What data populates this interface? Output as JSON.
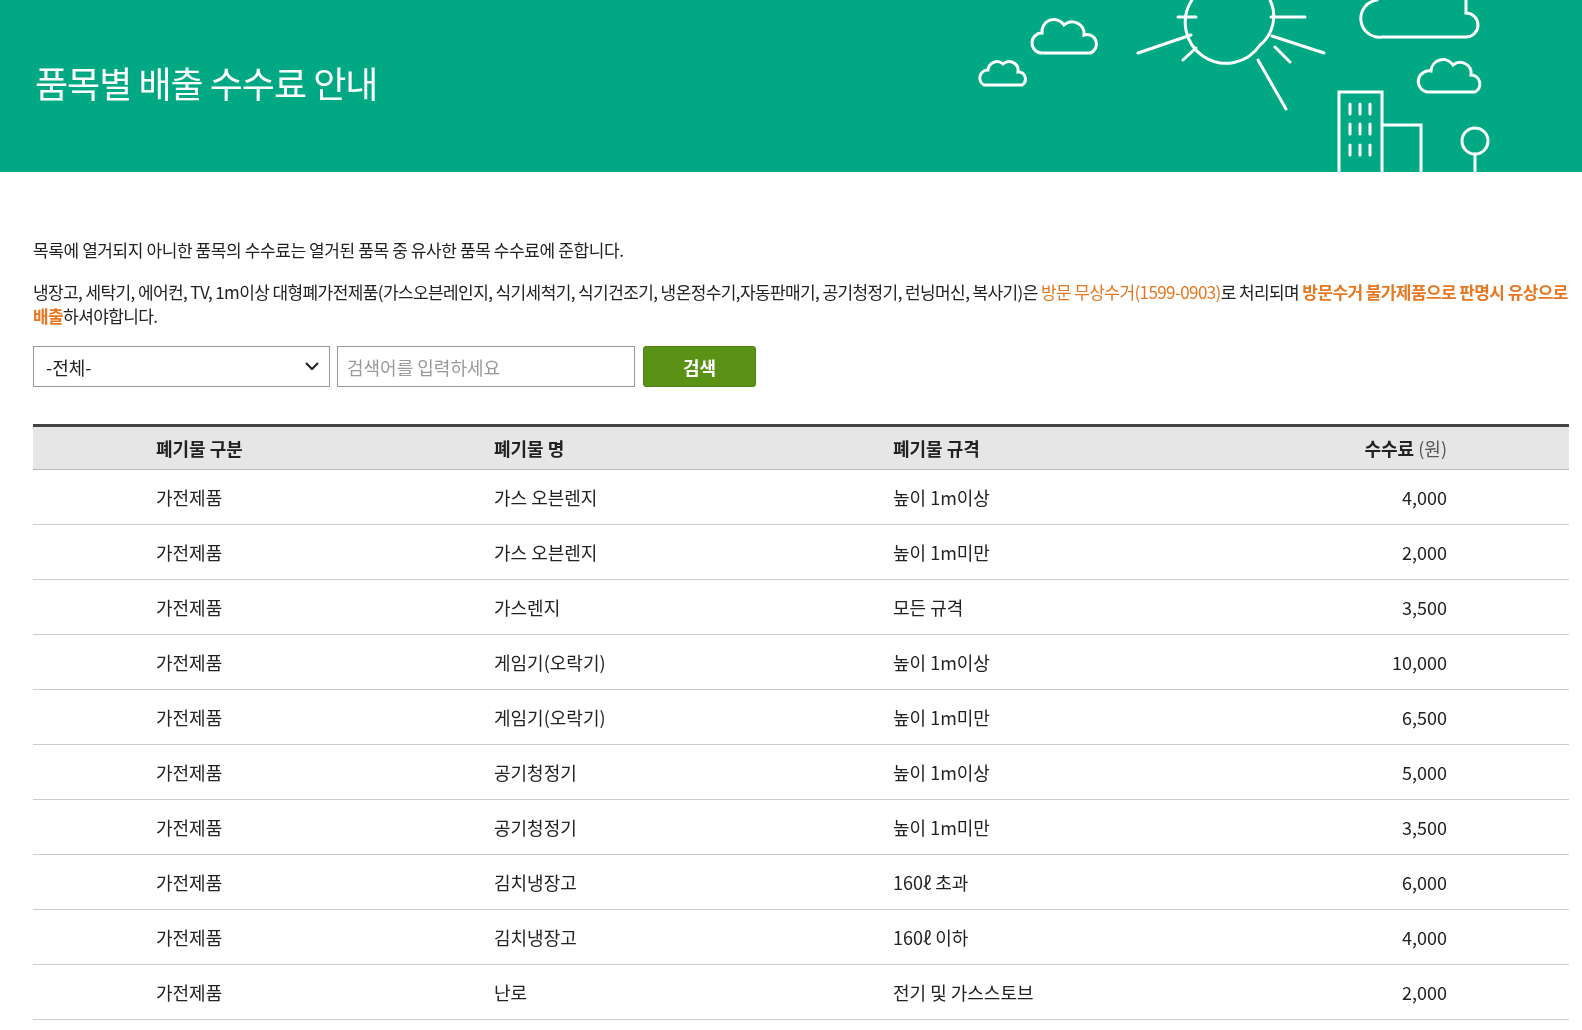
{
  "page_title": "품목별 배출 수수료 안내",
  "notice": "목록에 열거되지 아니한 품목의 수수료는 열거된 품목 중 유사한 품목 수수료에 준합니다.",
  "info": [
    {
      "kind": "plain",
      "text": "냉장고, 세탁기, 에어컨, TV, 1m이상 대형폐가전제품(가스오븐레인지, 식기세척기, 식기건조기, 냉온정수기,자동판매기, 공기청정기, 런닝머신, 복사기)은 "
    },
    {
      "kind": "highlight",
      "text": "방문 무상수거(1599-0903)"
    },
    {
      "kind": "plain",
      "text": "로 처리되며 "
    },
    {
      "kind": "strong",
      "text": "방문수거 불가제품으로 판명시 유상으로 배출"
    },
    {
      "kind": "plain",
      "text": "하셔야합니다."
    }
  ],
  "search": {
    "category": "-전체-",
    "placeholder": "검색어를 입력하세요",
    "button": "검색"
  },
  "table": {
    "columns": [
      {
        "label": "폐기물 구분"
      },
      {
        "label": "폐기물 명"
      },
      {
        "label": "폐기물 규격"
      },
      {
        "label": "수수료",
        "unit": "(원)"
      }
    ],
    "rows": [
      [
        "가전제품",
        "가스 오븐렌지",
        "높이 1m이상",
        "4,000"
      ],
      [
        "가전제품",
        "가스 오븐렌지",
        "높이 1m미만",
        "2,000"
      ],
      [
        "가전제품",
        "가스렌지",
        "모든 규격",
        "3,500"
      ],
      [
        "가전제품",
        "게임기(오락기)",
        "높이 1m이상",
        "10,000"
      ],
      [
        "가전제품",
        "게임기(오락기)",
        "높이 1m미만",
        "6,500"
      ],
      [
        "가전제품",
        "공기청정기",
        "높이 1m이상",
        "5,000"
      ],
      [
        "가전제품",
        "공기청정기",
        "높이 1m미만",
        "3,500"
      ],
      [
        "가전제품",
        "김치냉장고",
        "160ℓ 초과",
        "6,000"
      ],
      [
        "가전제품",
        "김치냉장고",
        "160ℓ 이하",
        "4,000"
      ],
      [
        "가전제품",
        "난로",
        "전기 및 가스스토브",
        "2,000"
      ]
    ]
  }
}
